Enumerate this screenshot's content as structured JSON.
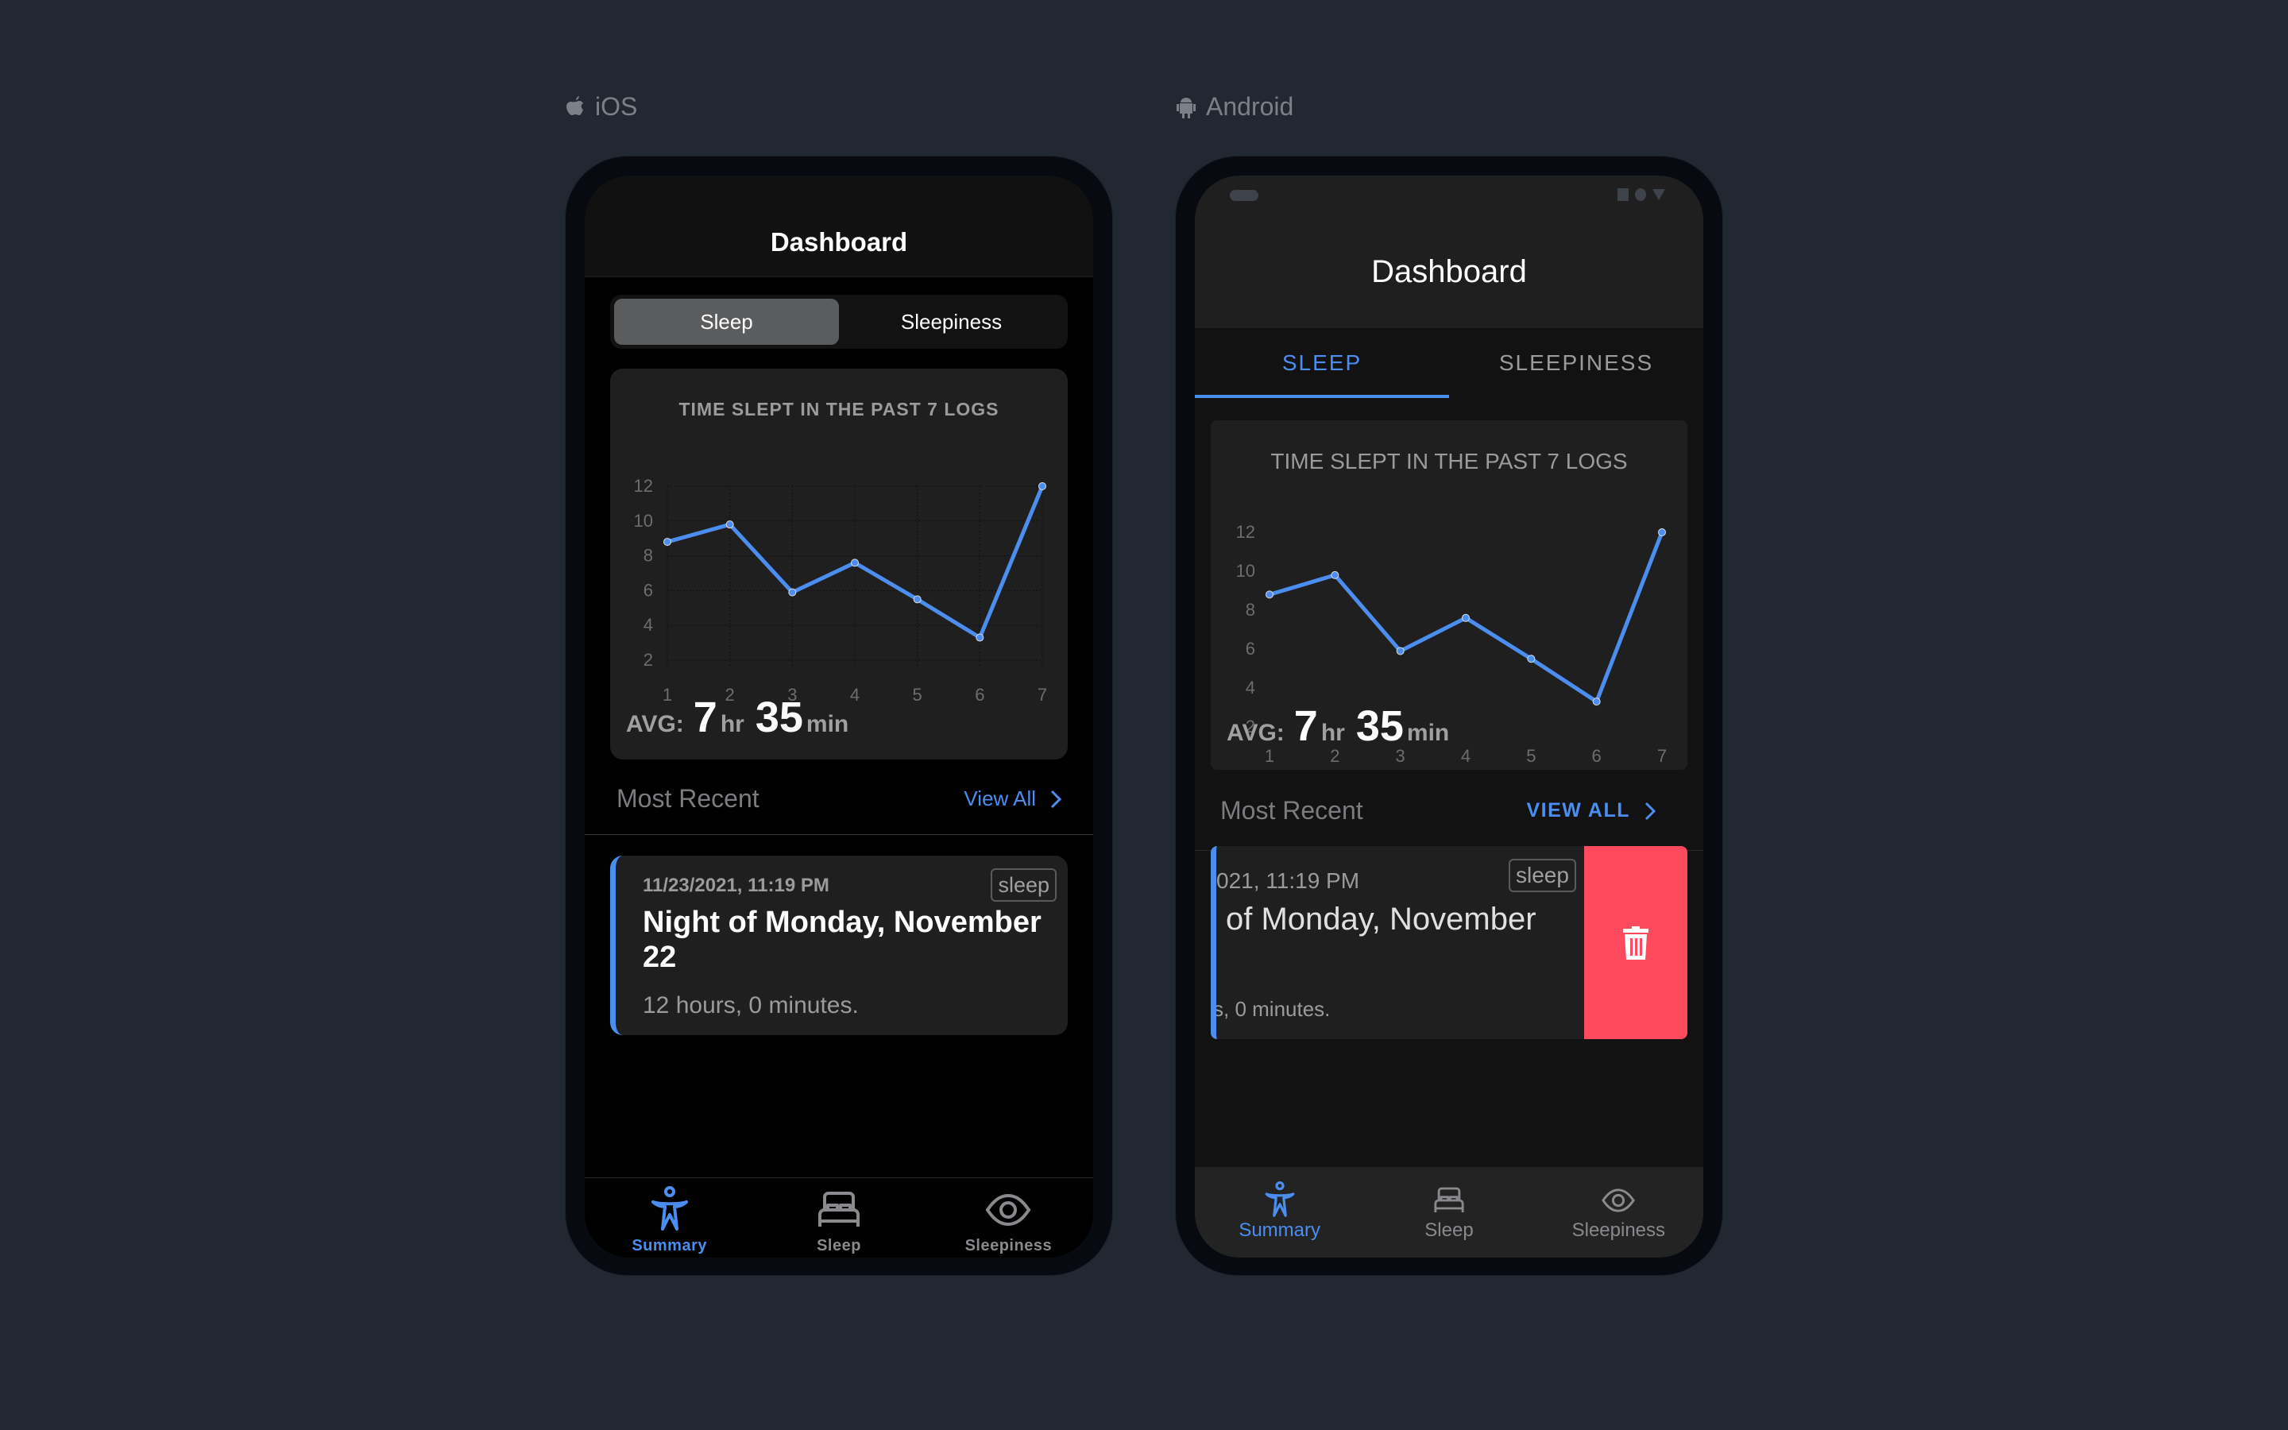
{
  "platforms": {
    "ios": {
      "label": "iOS",
      "icon": "apple-icon"
    },
    "android": {
      "label": "Android",
      "icon": "android-icon"
    }
  },
  "ios": {
    "header_title": "Dashboard",
    "segments": [
      {
        "label": "Sleep",
        "active": true
      },
      {
        "label": "Sleepiness",
        "active": false
      }
    ],
    "chart_title": "TIME SLEPT IN THE PAST 7 LOGS",
    "avg": {
      "label": "AVG:",
      "hours": "7",
      "hours_unit": "hr",
      "minutes": "35",
      "minutes_unit": "min"
    },
    "recent_title": "Most Recent",
    "view_all": "View All",
    "record": {
      "date": "11/23/2021, 11:19 PM",
      "tag": "sleep",
      "title": "Night of Monday, November 22",
      "duration": "12 hours, 0 minutes."
    },
    "tabs": [
      {
        "label": "Summary",
        "icon": "accessibility-icon",
        "active": true
      },
      {
        "label": "Sleep",
        "icon": "bed-icon",
        "active": false
      },
      {
        "label": "Sleepiness",
        "icon": "eye-icon",
        "active": false
      }
    ]
  },
  "android": {
    "header_title": "Dashboard",
    "tabs_top": [
      {
        "label": "SLEEP",
        "active": true
      },
      {
        "label": "SLEEPINESS",
        "active": false
      }
    ],
    "chart_title": "TIME SLEPT IN THE PAST 7 LOGS",
    "avg": {
      "label": "AVG:",
      "hours": "7",
      "hours_unit": "hr",
      "minutes": "35",
      "minutes_unit": "min"
    },
    "recent_title": "Most Recent",
    "view_all": "VIEW ALL",
    "record": {
      "date": "021, 11:19 PM",
      "tag": "sleep",
      "title": "of Monday, November",
      "duration": "s, 0 minutes.",
      "delete_icon": "trash-icon"
    },
    "tabs": [
      {
        "label": "Summary",
        "icon": "accessibility-icon",
        "active": true
      },
      {
        "label": "Sleep",
        "icon": "bed-icon",
        "active": false
      },
      {
        "label": "Sleepiness",
        "icon": "eye-icon",
        "active": false
      }
    ]
  },
  "colors": {
    "accent": "#4b8ef0",
    "delete": "#ff4a5e",
    "background": "#222831"
  },
  "chart_data": {
    "type": "line",
    "title": "TIME SLEPT IN THE PAST 7 LOGS",
    "x": [
      1,
      2,
      3,
      4,
      5,
      6,
      7
    ],
    "values": [
      8.8,
      9.8,
      5.9,
      7.6,
      5.5,
      3.3,
      12
    ],
    "xlabel": "",
    "ylabel": "",
    "yticks": [
      2,
      4,
      6,
      8,
      10,
      12
    ],
    "xticks": [
      1,
      2,
      3,
      4,
      5,
      6,
      7
    ],
    "ylim": [
      2,
      12
    ],
    "grid": true
  }
}
